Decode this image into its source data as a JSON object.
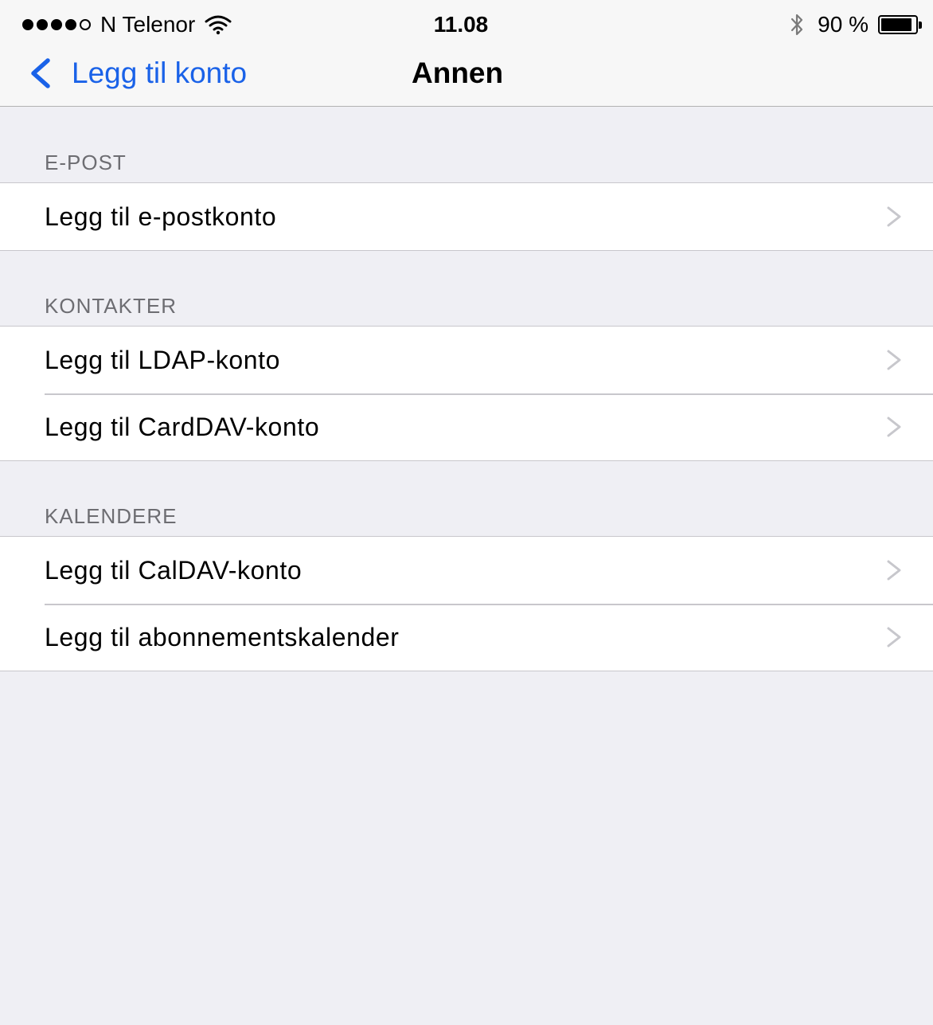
{
  "status_bar": {
    "signal_dots": [
      true,
      true,
      true,
      true,
      false
    ],
    "carrier": "N Telenor",
    "wifi_icon": "wifi-icon",
    "time": "11.08",
    "bluetooth_icon": "bluetooth-icon",
    "battery_percent": "90 %",
    "battery_level": 0.9
  },
  "nav": {
    "back_label": "Legg til konto",
    "back_icon": "chevron-left-icon",
    "title": "Annen",
    "tint_color": "#1a62e8"
  },
  "sections": [
    {
      "header": "E-POST",
      "items": [
        {
          "label": "Legg til e-postkonto"
        }
      ]
    },
    {
      "header": "KONTAKTER",
      "items": [
        {
          "label": "Legg til LDAP-konto"
        },
        {
          "label": "Legg til CardDAV-konto"
        }
      ]
    },
    {
      "header": "KALENDERE",
      "items": [
        {
          "label": "Legg til CalDAV-konto"
        },
        {
          "label": "Legg til abonnementskalender"
        }
      ]
    }
  ],
  "colors": {
    "background": "#efeff4",
    "section_header": "#6d6d72",
    "separator": "#c8c7cc",
    "chevron": "#c7c7cc"
  }
}
